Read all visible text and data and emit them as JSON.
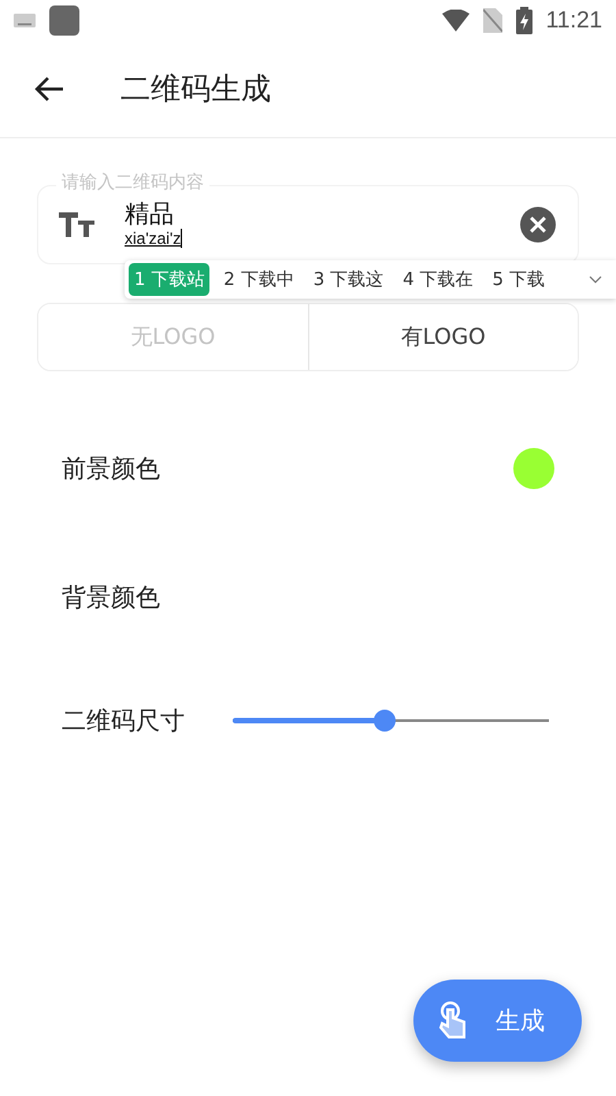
{
  "status_bar": {
    "time": "11:21"
  },
  "toolbar": {
    "title": "二维码生成"
  },
  "content_field": {
    "label": "请输入二维码内容",
    "value": "精品",
    "composing": "xia'zai'z"
  },
  "candidates": [
    {
      "index": "1",
      "text": "下载站",
      "selected": true
    },
    {
      "index": "2",
      "text": "下载中",
      "selected": false
    },
    {
      "index": "3",
      "text": "下载这",
      "selected": false
    },
    {
      "index": "4",
      "text": "下载在",
      "selected": false
    },
    {
      "index": "5",
      "text": "下载",
      "selected": false
    }
  ],
  "logo_options": [
    {
      "label": "无LOGO",
      "selected": false
    },
    {
      "label": "有LOGO",
      "selected": true
    }
  ],
  "settings": [
    {
      "kind": "color",
      "label": "前景颜色",
      "color": "#99ff33"
    },
    {
      "kind": "color",
      "label": "背景颜色"
    },
    {
      "kind": "slider",
      "label": "二维码尺寸",
      "level": 0.48
    }
  ],
  "fab": {
    "label": "生成"
  }
}
